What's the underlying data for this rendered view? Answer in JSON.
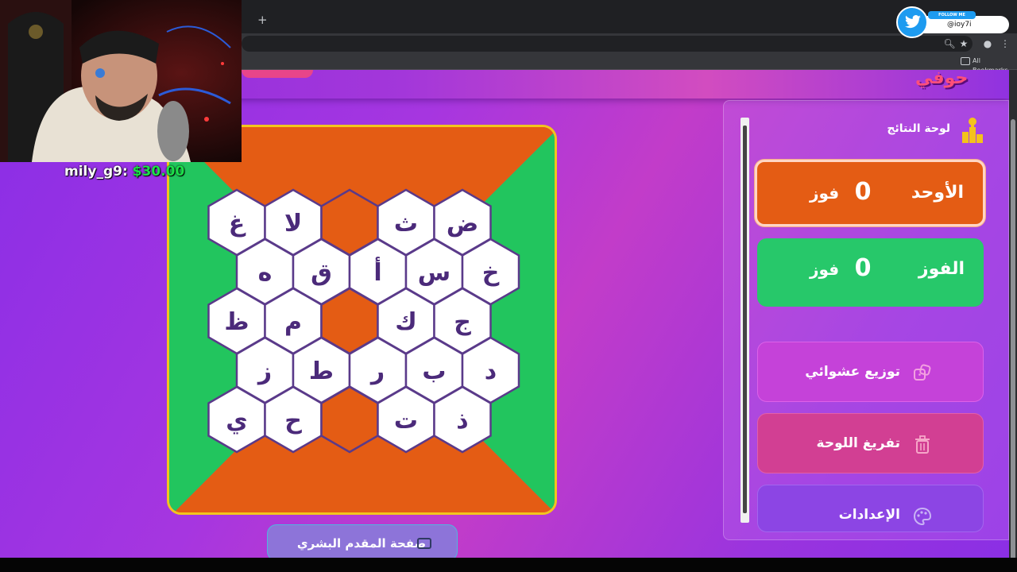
{
  "browser": {
    "new_tab_symbol": "+",
    "bookmarks_label": "All Bookmarks"
  },
  "twitter_overlay": {
    "follow_label": "FOLLOW ME",
    "handle": "@ioy7i",
    "brand_color": "#1d9bf0"
  },
  "stream": {
    "donation_user": "mily_g9:",
    "donation_amount": "$30.00"
  },
  "site": {
    "logo_fragment": "حوفي"
  },
  "board": {
    "colors": {
      "team1": "#e45c14",
      "team2": "#22c55e",
      "frame": "#f2c51d",
      "cell": "#ffffff",
      "cell_border": "#5a3a8a"
    },
    "rows": [
      [
        "غ",
        "لا",
        "",
        "ث",
        "ض"
      ],
      [
        "ه",
        "ق",
        "أ",
        "س",
        "خ"
      ],
      [
        "ظ",
        "م",
        "",
        "ك",
        "ج"
      ],
      [
        "ز",
        "ط",
        "ر",
        "ب",
        "د"
      ],
      [
        "ي",
        "ح",
        "",
        "ت",
        "ذ"
      ]
    ],
    "host_page_label": "صفحة المقدم البشري"
  },
  "panel": {
    "title": "لوحة النتائج",
    "teams": [
      {
        "name": "الأوحد",
        "score": "0",
        "unit": "فوز",
        "color": "#e45c14"
      },
      {
        "name": "الفوز",
        "score": "0",
        "unit": "فوز",
        "color": "#27c86a"
      }
    ],
    "actions": {
      "random": "توزيع عشوائي",
      "clear": "تفريغ اللوحة",
      "settings": "الإعدادات"
    }
  }
}
